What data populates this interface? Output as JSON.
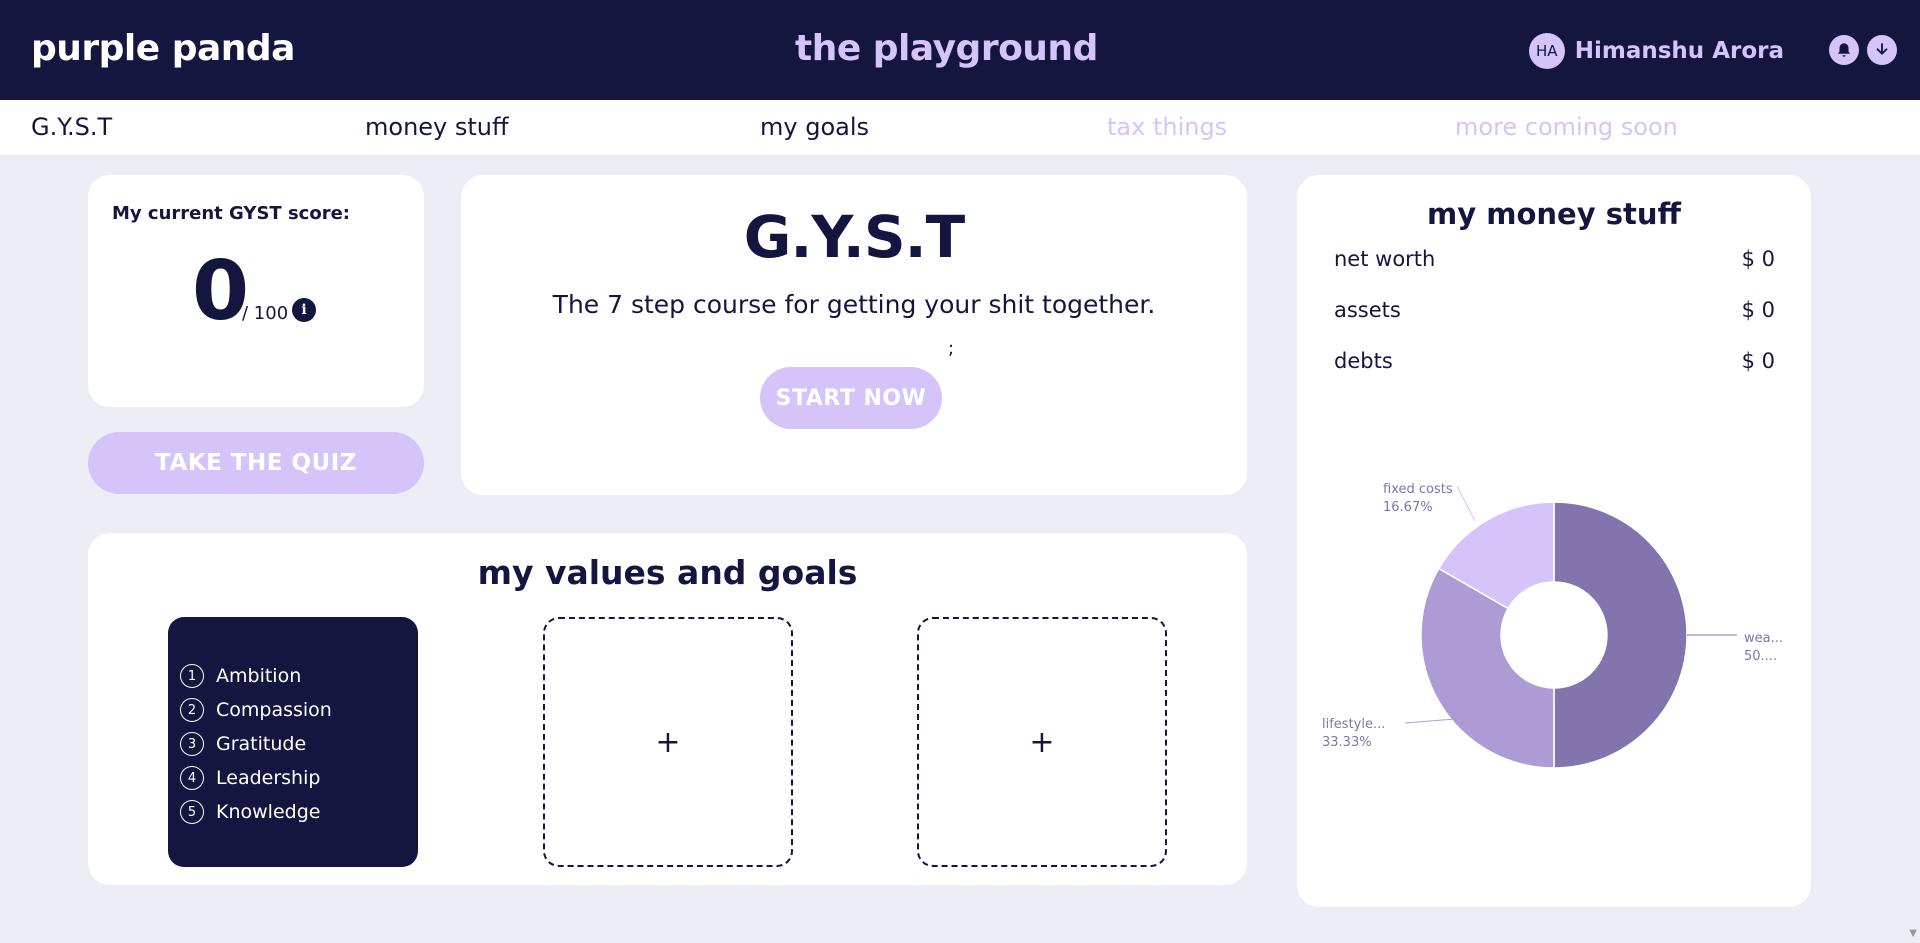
{
  "header": {
    "brand": "purple panda",
    "title": "the playground",
    "user_initials": "HA",
    "user_name": "Himanshu Arora",
    "icons": [
      "bell-icon",
      "download-icon"
    ]
  },
  "nav": {
    "items": [
      {
        "label": "G.Y.S.T",
        "active": true
      },
      {
        "label": "money stuff",
        "active": true
      },
      {
        "label": "my goals",
        "active": true
      },
      {
        "label": "tax things",
        "active": false
      },
      {
        "label": "more coming soon",
        "active": false
      }
    ]
  },
  "score": {
    "label": "My current GYST score:",
    "value": "0",
    "denominator": "/ 100",
    "info": "i"
  },
  "quiz_button": "TAKE THE QUIZ",
  "gyst": {
    "title": "G.Y.S.T",
    "subtitle": "The 7 step course for getting your shit together.",
    "stray": ";",
    "button": "START NOW"
  },
  "values": {
    "title": "my values and goals",
    "items": [
      {
        "num": "1",
        "label": "Ambition"
      },
      {
        "num": "2",
        "label": "Compassion"
      },
      {
        "num": "3",
        "label": "Gratitude"
      },
      {
        "num": "4",
        "label": "Leadership"
      },
      {
        "num": "5",
        "label": "Knowledge"
      }
    ],
    "add_symbol": "+"
  },
  "money": {
    "title": "my money stuff",
    "rows": [
      {
        "label": "net worth",
        "value": "$ 0"
      },
      {
        "label": "assets",
        "value": "$ 0"
      },
      {
        "label": "debts",
        "value": "$ 0"
      }
    ]
  },
  "chart_data": {
    "type": "pie",
    "donut": true,
    "slices": [
      {
        "name": "wea...",
        "label": "50....",
        "value": 50,
        "color": "#8374ad"
      },
      {
        "name": "lifestyle...",
        "label": "33.33%",
        "value": 33.33,
        "color": "#ad9bd6"
      },
      {
        "name": "fixed costs",
        "label": "16.67%",
        "value": 16.67,
        "color": "#d4c4fa"
      }
    ]
  },
  "colors": {
    "navy": "#141640",
    "lavender": "#d4c4fa",
    "background": "#ededf6"
  }
}
